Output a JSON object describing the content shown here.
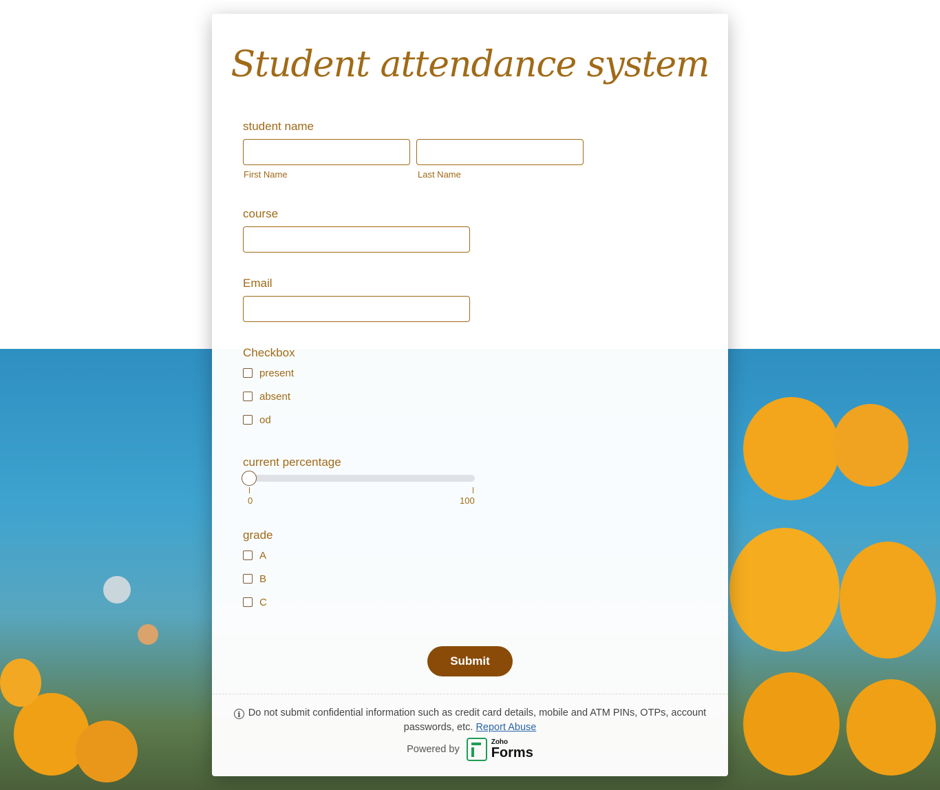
{
  "form": {
    "title": "Student attendance system",
    "student_name": {
      "label": "student name",
      "first_sublabel": "First Name",
      "last_sublabel": "Last Name",
      "first_value": "",
      "last_value": ""
    },
    "course": {
      "label": "course",
      "value": ""
    },
    "email": {
      "label": "Email",
      "value": ""
    },
    "checkbox": {
      "label": "Checkbox",
      "options": [
        {
          "label": "present",
          "checked": false
        },
        {
          "label": "absent",
          "checked": false
        },
        {
          "label": "od",
          "checked": false
        }
      ]
    },
    "percentage": {
      "label": "current percentage",
      "min_label": "0",
      "max_label": "100",
      "value": 0
    },
    "grade": {
      "label": "grade",
      "options": [
        {
          "label": "A",
          "checked": false
        },
        {
          "label": "B",
          "checked": false
        },
        {
          "label": "C",
          "checked": false
        }
      ]
    },
    "submit_label": "Submit"
  },
  "footer": {
    "info_icon": "info-icon",
    "notice": "Do not submit confidential information such as credit card details, mobile and ATM PINs, OTPs, account passwords, etc.",
    "report_link": "Report Abuse",
    "powered_by": "Powered by",
    "brand_small": "Zoho",
    "brand_big": "Forms"
  },
  "colors": {
    "accent": "#a06a17",
    "button": "#8a4b08",
    "logo": "#1f9d55"
  }
}
